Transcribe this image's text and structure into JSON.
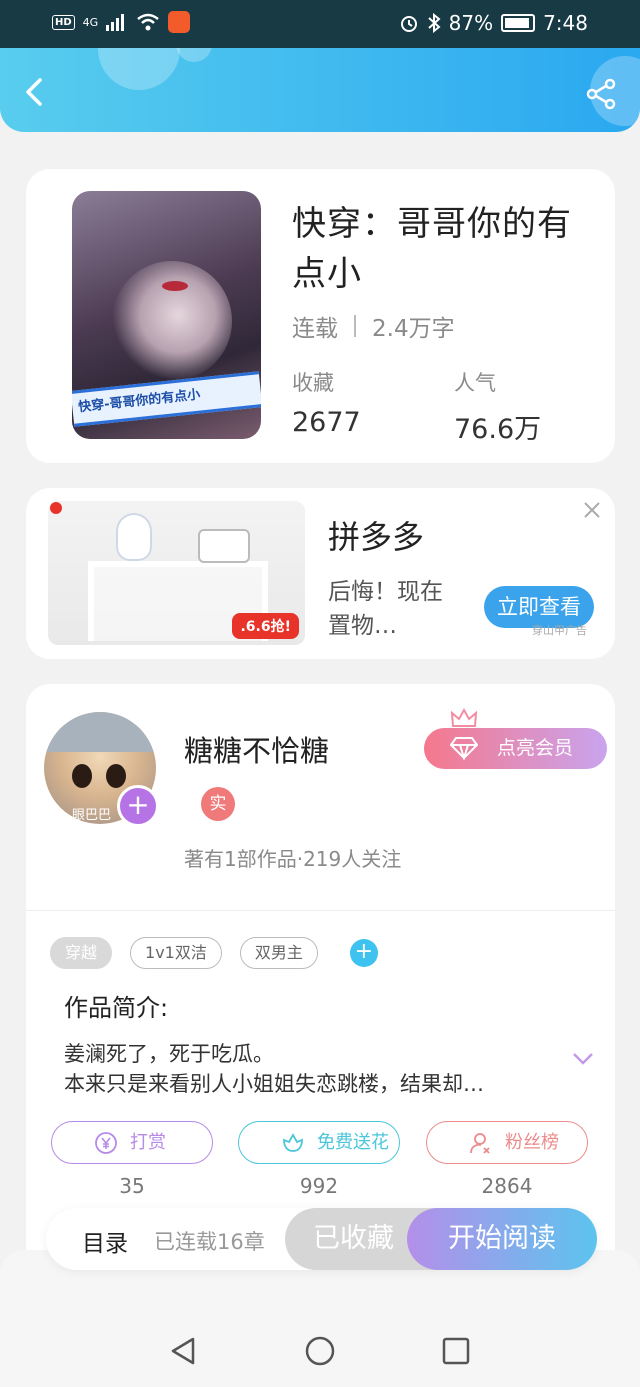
{
  "status_bar": {
    "hd": "HD",
    "network": "4G",
    "battery": "87%",
    "time": "7:48",
    "icons": [
      "signal-icon",
      "wifi-icon",
      "app-icon",
      "alarm-icon",
      "bluetooth-icon",
      "battery-icon"
    ]
  },
  "header": {
    "back_icon": "chevron-left-icon",
    "share_icon": "share-icon"
  },
  "book": {
    "title": "快穿：哥哥你的有点小",
    "cover_text": "快穿-哥哥你的有点小",
    "status": "连载",
    "word_count": "2.4万字",
    "stats": [
      {
        "label": "收藏",
        "value": "2677"
      },
      {
        "label": "人气",
        "value": "76.6万"
      }
    ]
  },
  "ad": {
    "title": "拼多多",
    "description": "后悔！现在置物…",
    "button": "立即查看",
    "promo": ".6.6抢!",
    "source": "穿山甲广告"
  },
  "author": {
    "name": "糖糖不恰糖",
    "avatar_text": "眼巴巴",
    "verify": "实",
    "stats": "著有1部作品·219人关注",
    "vip_button": "点亮会员"
  },
  "tags": [
    "穿越",
    "1v1双洁",
    "双男主"
  ],
  "intro": {
    "title": "作品简介:",
    "text_line1": "姜澜死了，死于吃瓜。",
    "text_line2": "本来只是来看别人小姐姐失恋跳楼，结果却…"
  },
  "actions": [
    {
      "label": "打赏",
      "count": "35",
      "icon": "yen-coin-icon"
    },
    {
      "label": "免费送花",
      "count": "992",
      "icon": "flower-icon"
    },
    {
      "label": "粉丝榜",
      "count": "2864",
      "icon": "fans-user-icon"
    }
  ],
  "bottom_bar": {
    "catalog": "目录",
    "chapters": "已连载16章",
    "collected": "已收藏",
    "read": "开始阅读"
  },
  "colors": {
    "header_gradient": [
      "#58cdee",
      "#2aa8f0"
    ],
    "vip_gradient": [
      "#f5788c",
      "#c9a4ee"
    ],
    "read_gradient": [
      "#b48fe9",
      "#5cc4ee"
    ],
    "ad_button": "#3aa3ec"
  }
}
